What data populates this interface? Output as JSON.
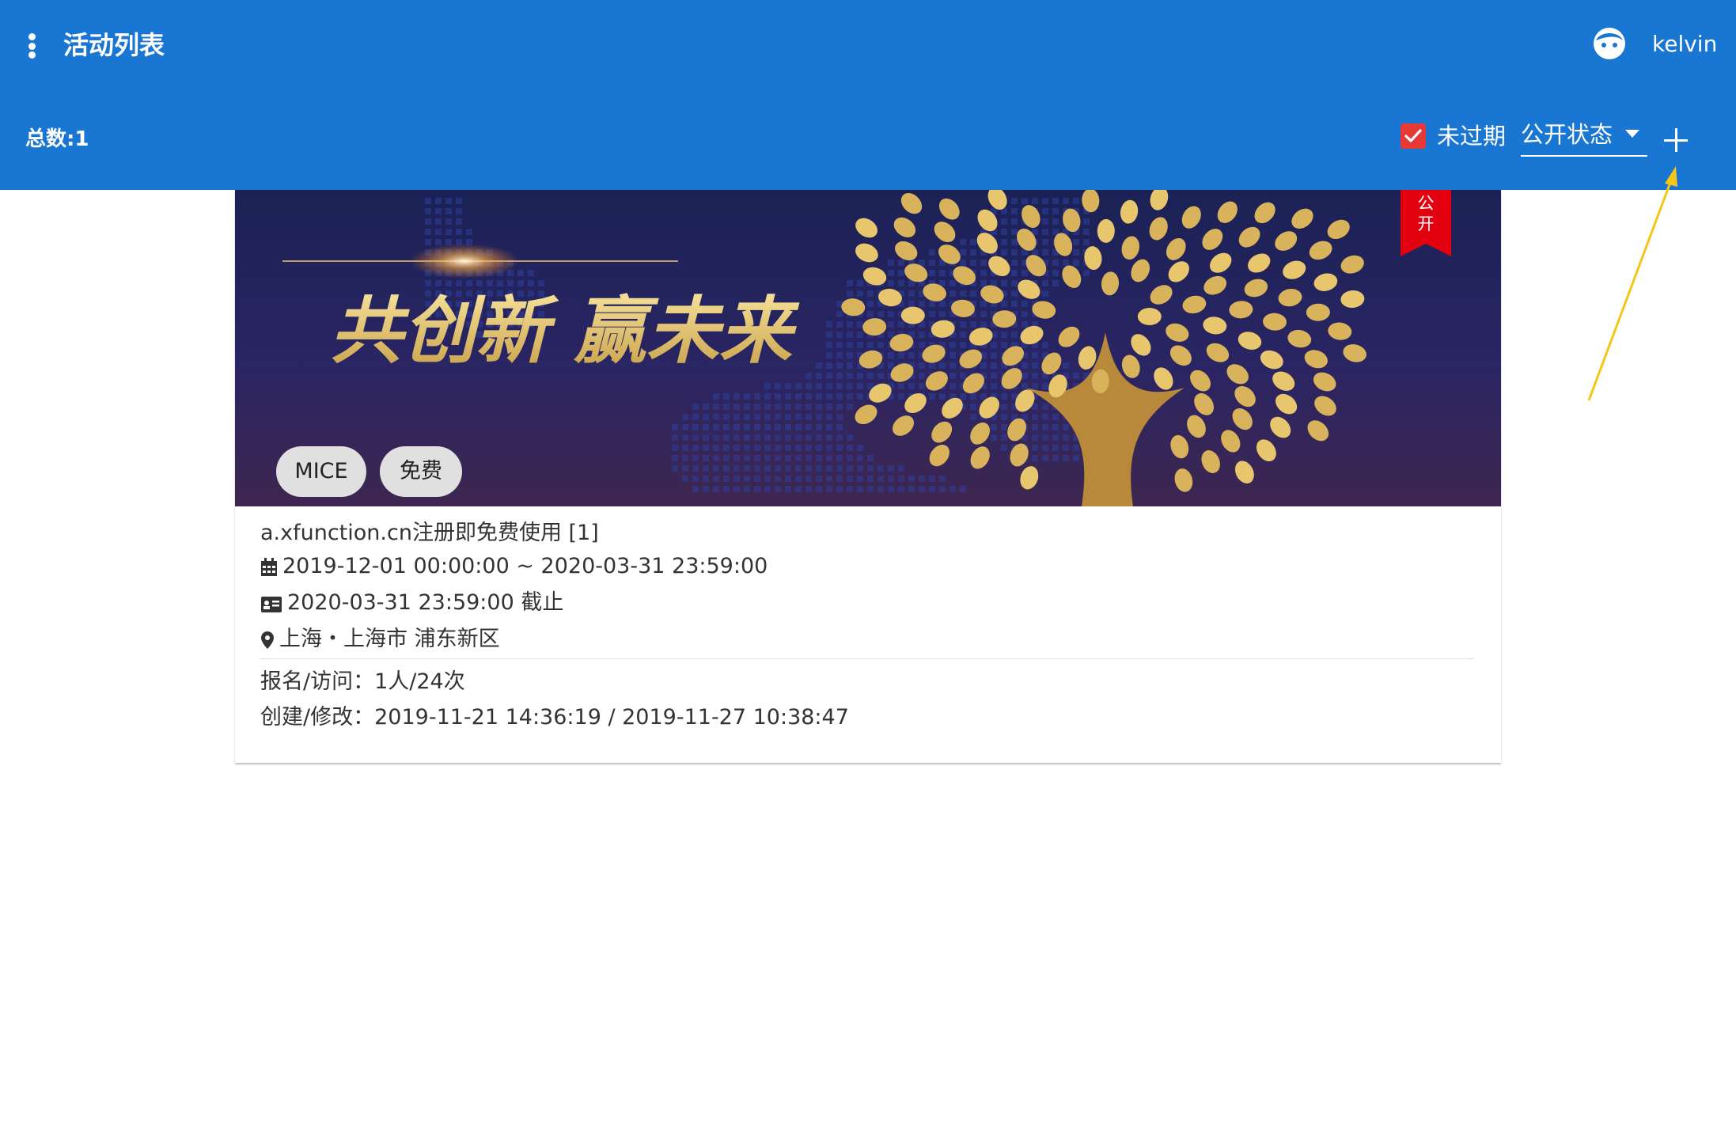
{
  "appbar": {
    "title": "活动列表",
    "username": "kelvin",
    "total_label": "总数:1",
    "unexpired_label": "未过期",
    "unexpired_checked": true,
    "status_select_value": "公开状态"
  },
  "colors": {
    "primary": "#1976d2",
    "checkbox": "#e53935",
    "ribbon": "#e3000f",
    "annotation_arrow": "#f5c518"
  },
  "card": {
    "banner_text": "共创新 赢未来",
    "ribbon": [
      "公",
      "开"
    ],
    "tags": [
      "MICE",
      "免费"
    ],
    "title": "a.xfunction.cn注册即免费使用 [1]",
    "date_range": "2019-12-01 00:00:00 ~ 2020-03-31 23:59:00",
    "deadline": "2020-03-31 23:59:00 截止",
    "location": "上海・上海市 浦东新区",
    "stats_label": "报名/访问：",
    "stats_value": "1人/24次",
    "times_label": "创建/修改：",
    "times_value": "2019-11-21 14:36:19 / 2019-11-27 10:38:47"
  },
  "icons": {
    "menu": "more-vert-icon",
    "avatar": "face-icon",
    "add": "plus-icon",
    "date": "calendar-icon",
    "deadline": "id-card-icon",
    "location": "map-marker-icon"
  }
}
